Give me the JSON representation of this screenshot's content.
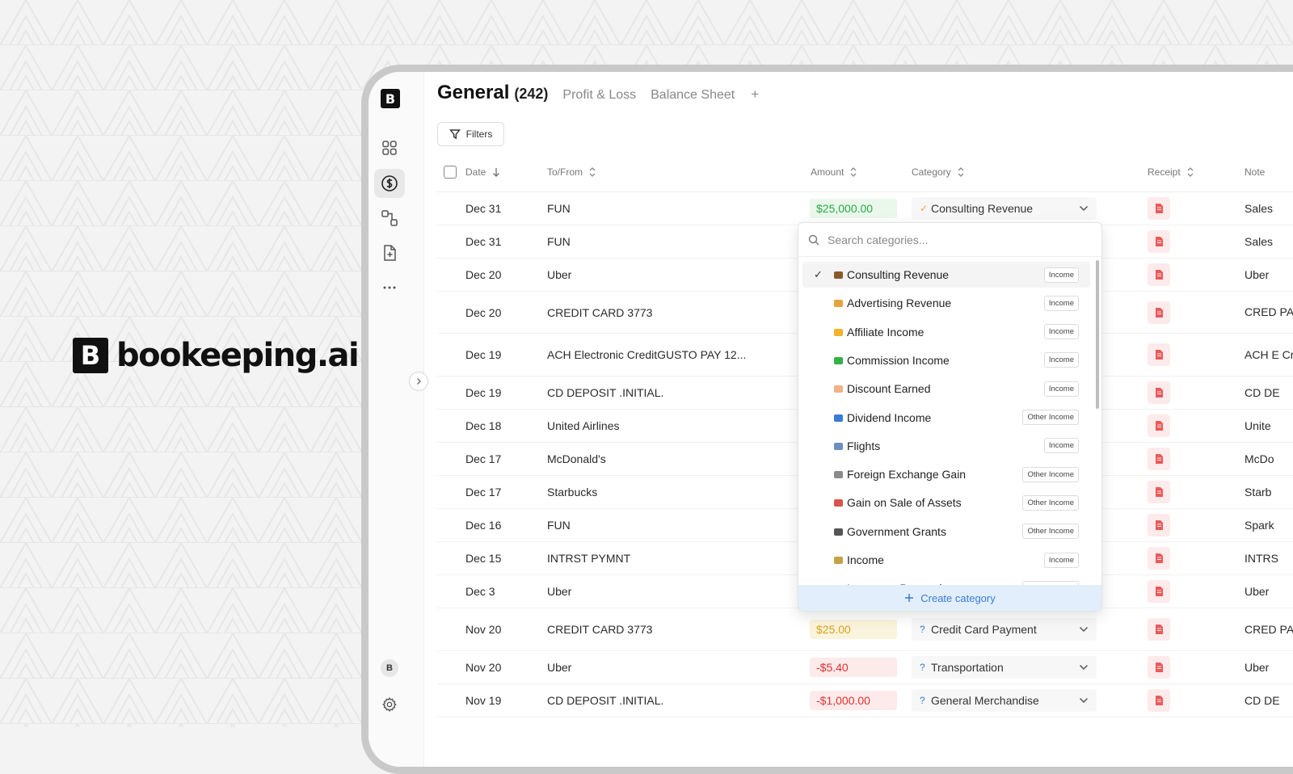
{
  "brand": {
    "mark": "B",
    "name": "bookeeping.ai"
  },
  "sidebar": {
    "logo": "B",
    "items": [
      {
        "icon": "dashboard-grid-icon"
      },
      {
        "icon": "dollar-circle-icon",
        "active": true
      },
      {
        "icon": "workflow-icon"
      },
      {
        "icon": "add-document-icon"
      },
      {
        "icon": "more-horizontal-icon"
      }
    ],
    "avatar": "B",
    "settings_icon": "gear-icon",
    "expand_icon": "chevron-right-icon"
  },
  "header": {
    "title": "General",
    "count": "(242)",
    "tabs": [
      "Profit & Loss",
      "Balance Sheet"
    ],
    "add_tab": "+"
  },
  "toolbar": {
    "filters_label": "Filters"
  },
  "table": {
    "columns": {
      "date": "Date",
      "to_from": "To/From",
      "amount": "Amount",
      "category": "Category",
      "receipt": "Receipt",
      "note": "Note"
    },
    "rows": [
      {
        "date": "Dec 31",
        "to_from": "FUN",
        "amount": "$25,000.00",
        "amount_type": "pos",
        "category": "Consulting Revenue",
        "category_status": "ok",
        "note": "Sales"
      },
      {
        "date": "Dec 31",
        "to_from": "FUN",
        "note": "Sales"
      },
      {
        "date": "Dec 20",
        "to_from": "Uber",
        "note": "Uber"
      },
      {
        "date": "Dec 20",
        "to_from": "CREDIT CARD 3773",
        "note": "CRED PAYM"
      },
      {
        "date": "Dec 19",
        "to_from": "ACH Electronic CreditGUSTO PAY 12...",
        "note": "ACH E Credi"
      },
      {
        "date": "Dec 19",
        "to_from": "CD DEPOSIT .INITIAL.",
        "note": "CD DE"
      },
      {
        "date": "Dec 18",
        "to_from": "United Airlines",
        "note": "Unite"
      },
      {
        "date": "Dec 17",
        "to_from": "McDonald's",
        "note": "McDo"
      },
      {
        "date": "Dec 17",
        "to_from": "Starbucks",
        "note": "Starb"
      },
      {
        "date": "Dec 16",
        "to_from": "FUN",
        "note": "Spark"
      },
      {
        "date": "Dec 15",
        "to_from": "INTRST PYMNT",
        "note": "INTRS"
      },
      {
        "date": "Dec 3",
        "to_from": "Uber",
        "note": "Uber"
      },
      {
        "date": "Nov 20",
        "to_from": "CREDIT CARD 3773",
        "amount": "$25.00",
        "amount_type": "warn",
        "category": "Credit Card Payment",
        "category_status": "q",
        "note": "CRED PAYM"
      },
      {
        "date": "Nov 20",
        "to_from": "Uber",
        "amount": "-$5.40",
        "amount_type": "neg",
        "category": "Transportation",
        "category_status": "q",
        "note": "Uber"
      },
      {
        "date": "Nov 19",
        "to_from": "CD DEPOSIT .INITIAL.",
        "amount": "-$1,000.00",
        "amount_type": "neg",
        "category": "General Merchandise",
        "category_status": "q",
        "note": "CD DE"
      }
    ]
  },
  "category_dropdown": {
    "search_placeholder": "Search categories...",
    "items": [
      {
        "label": "Consulting Revenue",
        "badge": "Income",
        "icon": "briefcase-icon",
        "selected": true
      },
      {
        "label": "Advertising Revenue",
        "badge": "Income",
        "icon": "megaphone-icon"
      },
      {
        "label": "Affiliate Income",
        "badge": "Income",
        "icon": "handshake-icon"
      },
      {
        "label": "Commission Income",
        "badge": "Income",
        "icon": "percent-icon"
      },
      {
        "label": "Discount Earned",
        "badge": "Income",
        "icon": "tag-icon"
      },
      {
        "label": "Dividend Income",
        "badge": "Other Income",
        "icon": "bar-chart-icon"
      },
      {
        "label": "Flights",
        "badge": "Income",
        "icon": "airplane-icon"
      },
      {
        "label": "Foreign Exchange Gain",
        "badge": "Other Income",
        "icon": "exchange-icon"
      },
      {
        "label": "Gain on Sale of Assets",
        "badge": "Other Income",
        "icon": "line-chart-icon"
      },
      {
        "label": "Government Grants",
        "badge": "Other Income",
        "icon": "bank-icon"
      },
      {
        "label": "Income",
        "badge": "Income",
        "icon": "money-bag-icon"
      },
      {
        "label": "Insurance Proceeds",
        "badge": "Other Income",
        "icon": "shield-icon"
      }
    ],
    "create_label": "Create category"
  },
  "colors": {
    "positive": "#27a844",
    "negative": "#e03131",
    "warning": "#d4a21c",
    "accent_blue": "#3a7bd5",
    "receipt_red": "#e84a4a"
  }
}
